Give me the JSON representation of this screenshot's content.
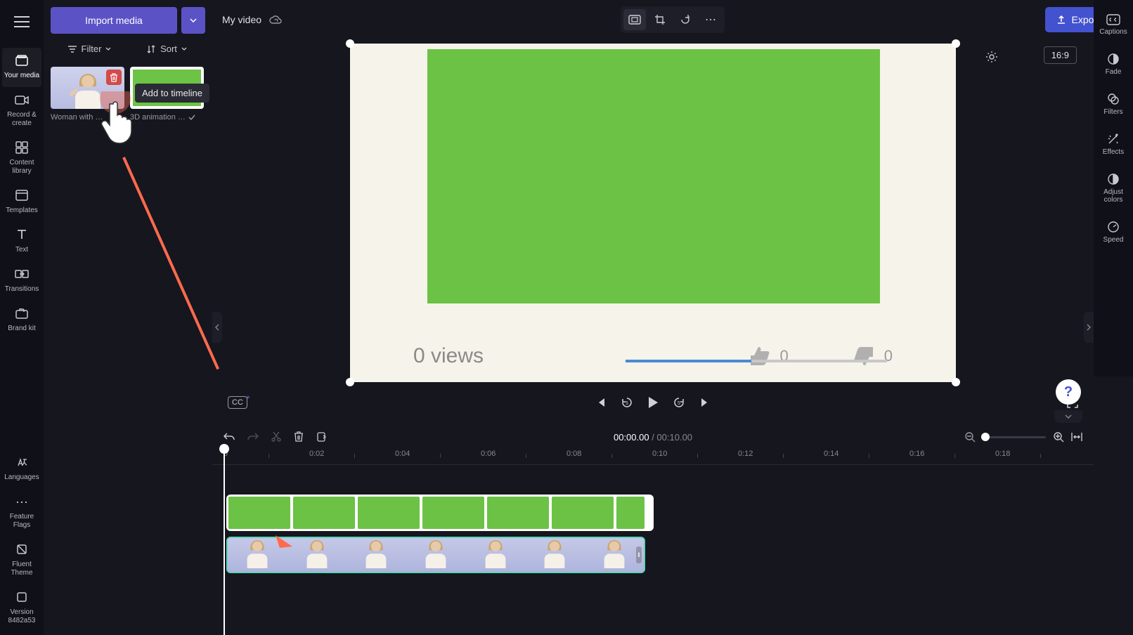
{
  "leftNav": {
    "items": [
      {
        "label": "Your media"
      },
      {
        "label": "Record & create"
      },
      {
        "label": "Content library"
      },
      {
        "label": "Templates"
      },
      {
        "label": "Text"
      },
      {
        "label": "Transitions"
      },
      {
        "label": "Brand kit"
      }
    ],
    "bottomItems": [
      {
        "label": "Languages"
      },
      {
        "label": "Feature Flags"
      },
      {
        "label": "Fluent Theme"
      },
      {
        "label": "Version 8482a53"
      }
    ]
  },
  "mediaPanel": {
    "importLabel": "Import media",
    "filterLabel": "Filter",
    "sortLabel": "Sort",
    "items": [
      {
        "label": "Woman with …"
      },
      {
        "label": "3D animation …"
      }
    ]
  },
  "tooltip": "Add to timeline",
  "topBar": {
    "title": "My video",
    "exportLabel": "Export"
  },
  "rightNav": {
    "items": [
      {
        "label": "Captions"
      },
      {
        "label": "Fade"
      },
      {
        "label": "Filters"
      },
      {
        "label": "Effects"
      },
      {
        "label": "Adjust colors"
      },
      {
        "label": "Speed"
      }
    ]
  },
  "preview": {
    "ratioLabel": "16:9",
    "viewsText": "0 views",
    "likeCount": "0",
    "dislikeCount": "0",
    "ccLabel": "CC"
  },
  "editBar": {
    "currentTime": "00:00.00",
    "sep": " / ",
    "duration": "00:10.00"
  },
  "ruler": {
    "ticks": [
      "0",
      "0:02",
      "0:04",
      "0:06",
      "0:08",
      "0:10",
      "0:12",
      "0:14",
      "0:16",
      "0:18"
    ]
  },
  "help": "?"
}
